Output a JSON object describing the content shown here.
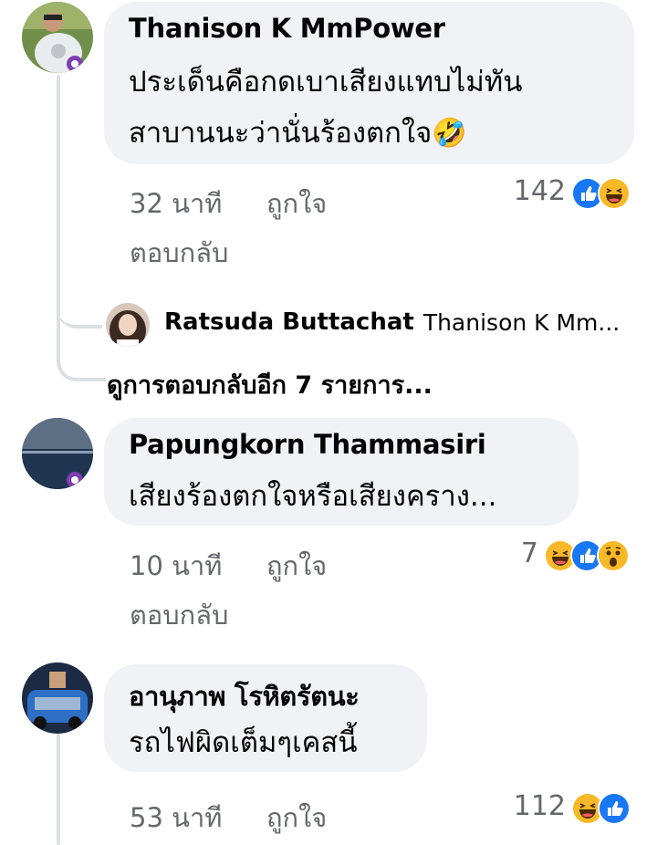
{
  "comments": [
    {
      "author": "Thanison K MmPower",
      "lines": [
        "ประเด็นคือกดเบาเสียงแทบไม่ทัน",
        "สาบานนะว่านั่นร้องตกใจ🤣"
      ],
      "time": "32 นาที",
      "like_label": "ถูกใจ",
      "reply_label": "ตอบกลับ",
      "reaction_count": "142",
      "reactions": [
        "like-icon",
        "haha-icon"
      ]
    },
    {
      "author": "Papungkorn Thammasiri",
      "lines": [
        "เสียงร้องตกใจหรือเสียงคราง..."
      ],
      "time": "10 นาที",
      "like_label": "ถูกใจ",
      "reply_label": "ตอบกลับ",
      "reaction_count": "7",
      "reactions": [
        "haha-icon",
        "like-icon",
        "wow-icon"
      ]
    },
    {
      "author": "อานุภาพ โรหิตรัตนะ",
      "lines": [
        "รถไฟผิดเต็มๆเคสนี้"
      ],
      "time": "53 นาที",
      "like_label": "ถูกใจ",
      "reaction_count": "112",
      "reactions": [
        "haha-icon",
        "like-icon"
      ]
    }
  ],
  "reply_preview": {
    "author": "Ratsuda Buttachat",
    "text": "Thanison K Mm..."
  },
  "more_replies": "ดูการตอบกลับอีก 7 รายการ...",
  "colors": {
    "bubble": "#f0f2f5",
    "secondary_text": "#65676b",
    "like_blue": "#1877f2",
    "haha_yellow": "#f7b928"
  }
}
